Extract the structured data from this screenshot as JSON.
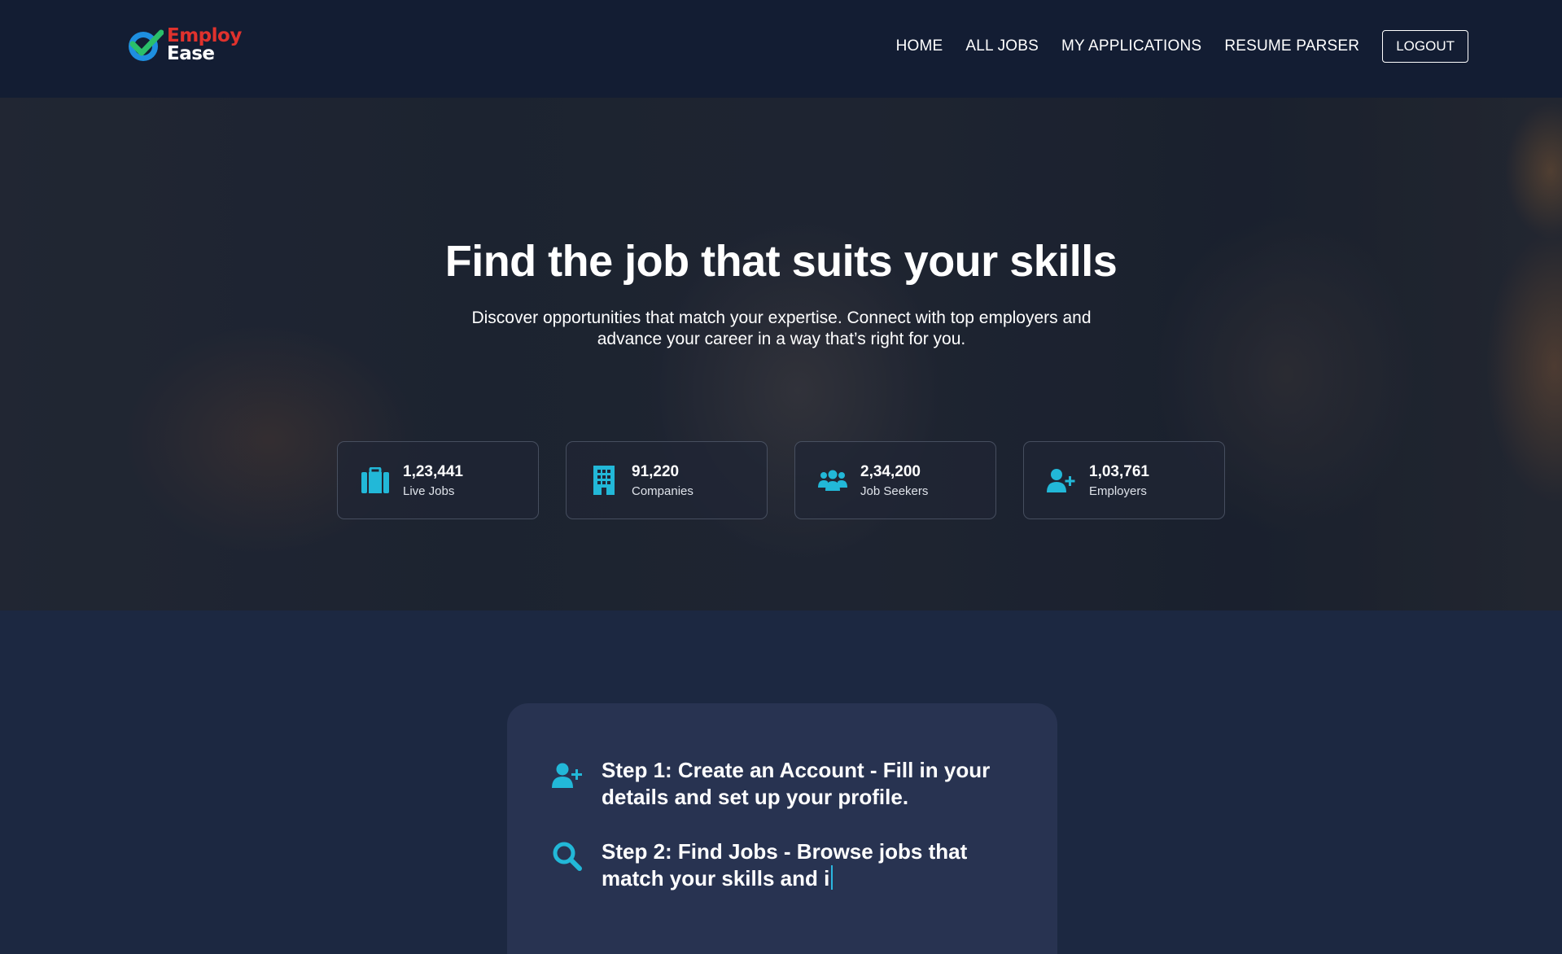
{
  "brand": {
    "line1": "Employ",
    "line2": "Ease",
    "colors": {
      "red": "#e0322d",
      "blue": "#1e8fe0",
      "green": "#2bbf6a"
    }
  },
  "nav": {
    "items": [
      {
        "label": "HOME"
      },
      {
        "label": "ALL JOBS"
      },
      {
        "label": "MY APPLICATIONS"
      },
      {
        "label": "RESUME PARSER"
      }
    ],
    "logout_label": "LOGOUT"
  },
  "hero": {
    "title": "Find the job that suits your skills",
    "subtitle": "Discover opportunities that match your expertise. Connect with top employers and advance your career in a way that’s right for you."
  },
  "stats": [
    {
      "icon": "briefcase-icon",
      "value": "1,23,441",
      "label": "Live Jobs"
    },
    {
      "icon": "building-icon",
      "value": "91,220",
      "label": "Companies"
    },
    {
      "icon": "users-icon",
      "value": "2,34,200",
      "label": "Job Seekers"
    },
    {
      "icon": "user-plus-icon",
      "value": "1,03,761",
      "label": "Employers"
    }
  ],
  "steps": [
    {
      "icon": "user-plus-icon",
      "text": "Step 1: Create an Account - Fill in your details and set up your profile."
    },
    {
      "icon": "search-icon",
      "text": "Step 2: Find Jobs - Browse jobs that match your skills and i"
    }
  ],
  "accent_color": "#22b8d8"
}
